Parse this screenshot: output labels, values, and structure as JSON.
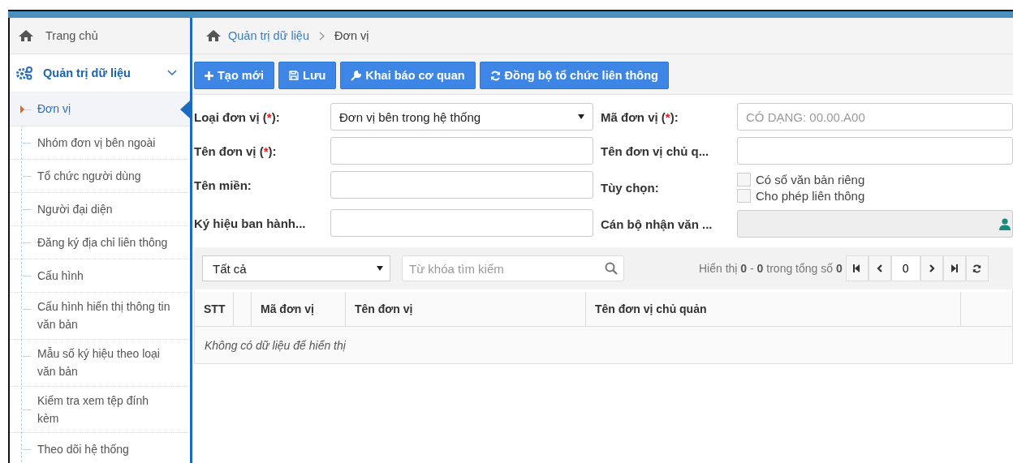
{
  "breadcrumb": {
    "home_label": "Quản trị dữ liệu",
    "current": "Đơn vị"
  },
  "sidebar": {
    "home": "Trang chủ",
    "group": {
      "label": "Quản trị dữ liệu",
      "expanded": true
    },
    "items": [
      {
        "label": "Đơn vị",
        "selected": true
      },
      {
        "label": "Nhóm đơn vị bên ngoài",
        "selected": false
      },
      {
        "label": "Tổ chức người dùng",
        "selected": false
      },
      {
        "label": "Người đại diện",
        "selected": false
      },
      {
        "label": "Đăng ký địa chỉ liên thông",
        "selected": false
      },
      {
        "label": "Cấu hình",
        "selected": false
      },
      {
        "label": "Cấu hình hiển thị thông tin văn bản",
        "selected": false
      },
      {
        "label": "Mẫu số ký hiệu theo loại văn bản",
        "selected": false
      },
      {
        "label": "Kiểm tra xem tệp đính kèm",
        "selected": false
      },
      {
        "label": "Theo dõi hệ thống",
        "selected": false
      }
    ]
  },
  "toolbar": [
    {
      "kind": "plus",
      "label": "Tạo mới"
    },
    {
      "kind": "save",
      "label": "Lưu"
    },
    {
      "kind": "wrench",
      "label": "Khai báo cơ quan"
    },
    {
      "kind": "sync",
      "label": "Đồng bộ tổ chức liên thông"
    }
  ],
  "form": {
    "left": [
      {
        "label": "Loại đơn vị (*):",
        "kind": "select",
        "value": "Đơn vị bên trong hệ thống"
      },
      {
        "label": "Tên đơn vị (*):",
        "kind": "input"
      },
      {
        "label": "Tên miền:",
        "kind": "input"
      },
      {
        "label": "Ký hiệu ban hành...",
        "kind": "input"
      }
    ],
    "right": [
      {
        "label": "Mã đơn vị (*):",
        "kind": "input",
        "placeholder": "CÓ DẠNG: 00.00.A00"
      },
      {
        "label": "Tên đơn vị chủ q...",
        "kind": "input"
      },
      {
        "label": "Tùy chọn:",
        "kind": "checks",
        "options": [
          {
            "label": "Có sổ văn bản riêng",
            "checked": false
          },
          {
            "label": "Cho phép liên thông",
            "checked": false
          }
        ]
      },
      {
        "label": "Cán bộ nhận văn ...",
        "kind": "user"
      }
    ]
  },
  "list": {
    "filter": "Tất cả",
    "search_placeholder": "Từ khóa tìm kiếm",
    "summary": "Hiển thị **0** - **0** trong tổng số **0**",
    "page": "0",
    "columns": [
      "STT",
      "",
      "Mã đơn vị",
      "Tên đơn vị",
      "Tên đơn vị chủ quản",
      ""
    ],
    "empty": "Không có dữ liệu để hiển thị"
  }
}
